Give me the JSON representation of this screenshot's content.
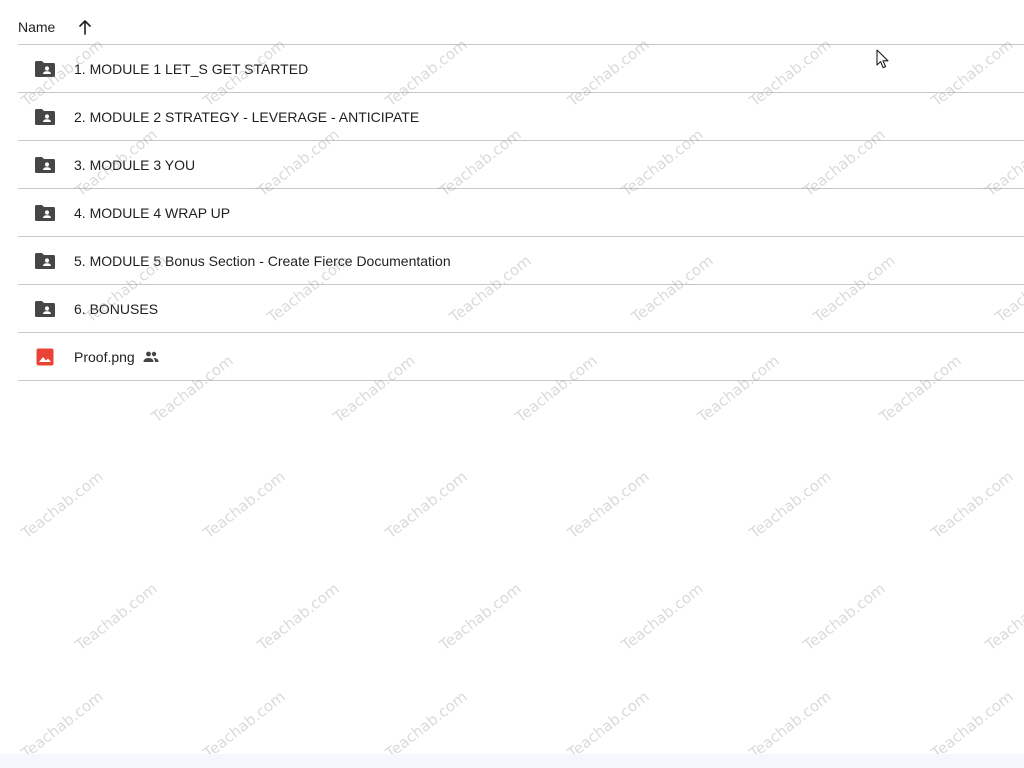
{
  "header": {
    "name_label": "Name",
    "sort_icon": "arrow-up-icon"
  },
  "files": [
    {
      "name": "1. MODULE 1 LET_S GET STARTED",
      "type": "shared-folder",
      "icon": "shared-folder-icon"
    },
    {
      "name": "2. MODULE 2 STRATEGY - LEVERAGE - ANTICIPATE",
      "type": "shared-folder",
      "icon": "shared-folder-icon"
    },
    {
      "name": "3. MODULE 3 YOU",
      "type": "shared-folder",
      "icon": "shared-folder-icon"
    },
    {
      "name": "4. MODULE 4 WRAP UP",
      "type": "shared-folder",
      "icon": "shared-folder-icon"
    },
    {
      "name": "5. MODULE 5 Bonus Section - Create Fierce Documentation",
      "type": "shared-folder",
      "icon": "shared-folder-icon"
    },
    {
      "name": "6. BONUSES",
      "type": "shared-folder",
      "icon": "shared-folder-icon"
    },
    {
      "name": "Proof.png",
      "type": "image",
      "icon": "image-file-icon",
      "shared": true,
      "shared_icon": "people-icon"
    }
  ],
  "watermark_text": "Teachab.com",
  "colors": {
    "folder_icon": "#444746",
    "image_icon": "#ea4335",
    "divider": "#c7c7c7"
  }
}
